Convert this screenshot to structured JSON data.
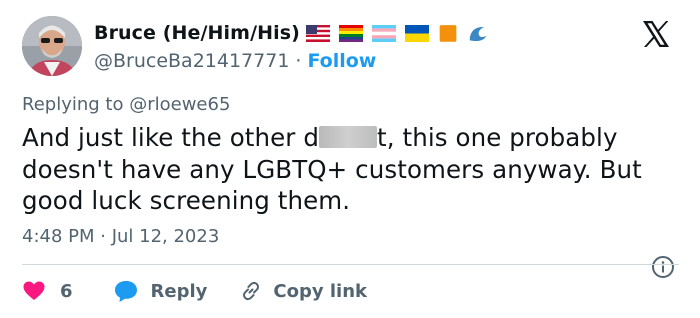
{
  "user": {
    "display_name": "Bruce (He/Him/His)",
    "handle": "@BruceBa21417771",
    "separator": "·",
    "follow_label": "Follow",
    "name_flags": [
      "us-flag-icon",
      "rainbow-flag-icon",
      "trans-flag-icon",
      "ukraine-flag-icon",
      "orange-square-icon",
      "wave-icon"
    ]
  },
  "tweet": {
    "replying_prefix": "Replying to",
    "replying_to": "@rloewe65",
    "text_part1": "And just like the other d",
    "text_part2": "t, this one probably doesn't have any LGBTQ+ customers anyway.  But good luck screening them.",
    "time": "4:48 PM · Jul 12, 2023"
  },
  "actions": {
    "like_count": "6",
    "reply_label": "Reply",
    "copy_label": "Copy link"
  },
  "colors": {
    "accent": "#1d9bf0",
    "like": "#f91880",
    "secondary_text": "#536471",
    "primary_text": "#0f1419"
  }
}
